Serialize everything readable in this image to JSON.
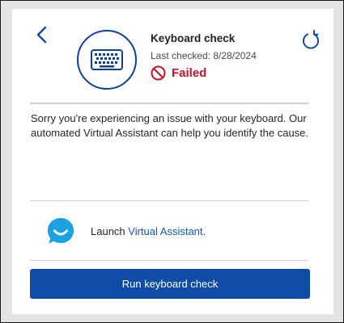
{
  "header": {
    "title": "Keyboard check",
    "last_checked": "Last checked: 8/28/2024",
    "status": "Failed"
  },
  "icons": {
    "back": "back-chevron-icon",
    "refresh": "refresh-icon",
    "device": "keyboard-icon",
    "status": "failed-icon",
    "assistant": "virtual-assistant-icon"
  },
  "message": "Sorry you're experiencing an issue with your keyboard. Our automated Virtual Assistant can help you identify the cause.",
  "assistant": {
    "launch_prefix": "Launch ",
    "link_label": "Virtual Assistant",
    "suffix": "."
  },
  "actions": {
    "run_label": "Run keyboard check"
  },
  "colors": {
    "accent": "#0e4ca8",
    "failed": "#c8102e",
    "link": "#1356b7",
    "assistant": "#1aa3e0"
  }
}
